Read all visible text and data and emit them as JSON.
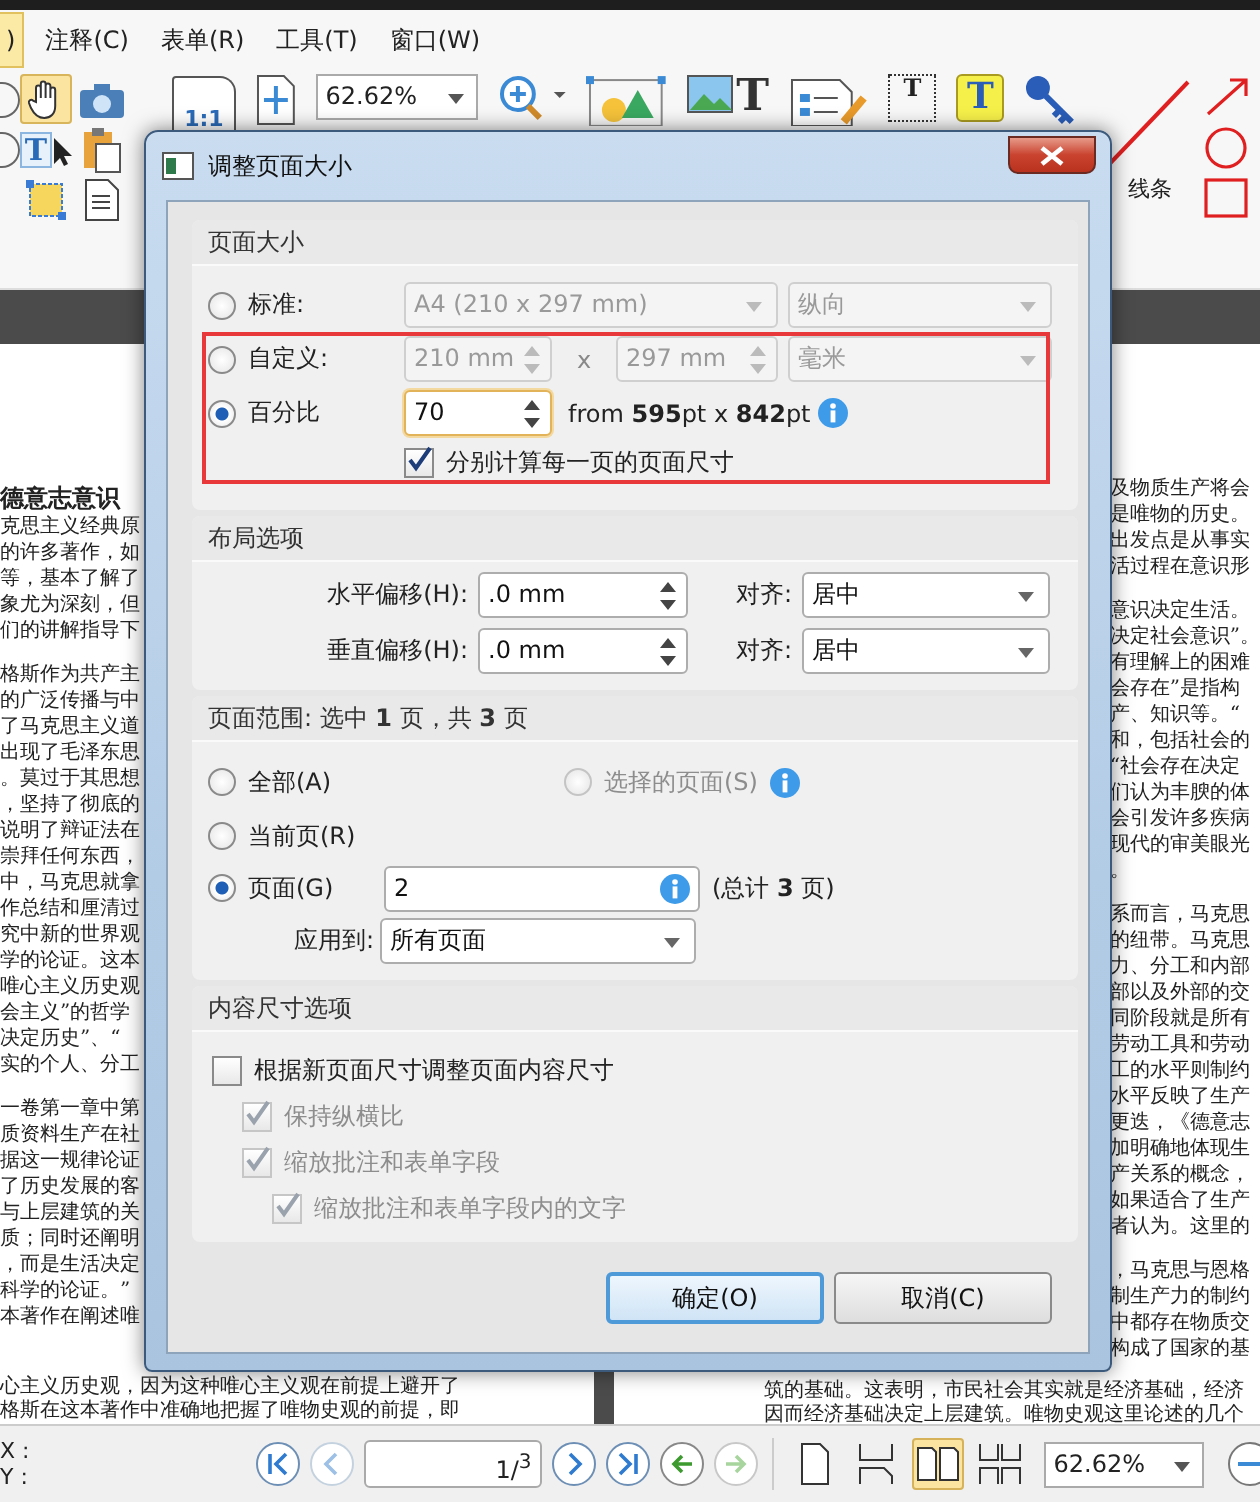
{
  "menu_bar": [
    {
      "label": ")",
      "selected": true
    },
    {
      "label": "注释(C)",
      "selected": false
    },
    {
      "label": "表单(R)",
      "selected": false
    },
    {
      "label": "工具(T)",
      "selected": false
    },
    {
      "label": "窗口(W)",
      "selected": false
    }
  ],
  "toolbar": {
    "left_tools": [
      {
        "kind": "ellipse",
        "selected": false
      },
      {
        "kind": "hand",
        "selected": true
      },
      {
        "kind": "camera",
        "selected": false
      },
      {
        "kind": "ellipse",
        "selected": false
      },
      {
        "kind": "text-select",
        "glyph": "T",
        "selected": false
      },
      {
        "kind": "clipboard",
        "selected": false
      },
      {
        "kind": "select-box",
        "selected": false
      },
      {
        "kind": "document",
        "selected": false
      }
    ],
    "tools": [
      {
        "kind": "actual-size",
        "glyph": "1:1"
      },
      {
        "kind": "fit-page"
      },
      {
        "kind": "zoom-box",
        "value": "62.62%"
      },
      {
        "kind": "zoom-in"
      },
      {
        "kind": "shape"
      },
      {
        "kind": "image-text",
        "glyph": "T"
      },
      {
        "kind": "form-list"
      },
      {
        "kind": "text-field",
        "glyph": "T"
      },
      {
        "kind": "typewriter",
        "glyph": "T"
      },
      {
        "kind": "key"
      }
    ],
    "draw_tools": [
      {
        "kind": "arrow"
      },
      {
        "kind": "circle"
      },
      {
        "kind": "rectangle"
      }
    ],
    "line_label": "线条"
  },
  "left_page": {
    "heading": "德意志意识",
    "paragraphs": [
      [
        "克思主义经典原",
        "的许多著作，如",
        "等，基本了解了",
        "象尤为深刻，但",
        "们的讲解指导下"
      ],
      [
        "格斯作为共产主",
        "的广泛传播与中",
        "了马克思主义道",
        "出现了毛泽东思",
        "。莫过于其思想",
        "，坚持了彻底的",
        "说明了辩证法在",
        "崇拜任何东西，",
        "中，马克思就拿",
        "作总结和厘清过",
        "究中新的世界观",
        "学的论证。这本",
        "唯心主义历史观",
        "会主义”的哲学",
        "决定历史”、“",
        "实的个人、分工"
      ],
      [
        "一卷第一章中第",
        "质资料生产在社",
        "据这一规律论证",
        "了历史发展的客",
        "与上层建筑的关",
        "质；同时还阐明",
        "，而是生活决定",
        "科学的论证。”",
        "本著作在阐述唯"
      ]
    ],
    "tail": [
      "心主义历史观，因为这种唯心主义观在前提上避开了",
      "格斯在这本著作中准确地把握了唯物史观的前提，即"
    ]
  },
  "right_page": {
    "paragraphs": [
      [
        "及物质生产将会",
        "是唯物的历史。",
        "出发点是从事实",
        "活过程在意识形"
      ],
      [
        "意识决定生活。",
        "决定社会意识”。",
        "有理解上的困难",
        "会存在”是指构",
        "产、知识等。“",
        "和，包括社会的",
        "“社会存在决定",
        "们认为丰腴的体",
        "会引发许多疾病",
        "现代的审美眼光",
        "。"
      ],
      [
        "系而言，马克思",
        "的纽带。马克思",
        "力、分工和内部",
        "部以及外部的交",
        "同阶段就是所有",
        "劳动工具和劳动",
        "工的水平则制约",
        "水平反映了生产",
        "更迭，《德意志",
        "加明确地体现生",
        "产关系的概念，",
        "如果适合了生产",
        "者认为。这里的"
      ],
      [
        "，马克思与恩格",
        "制生产力的制约",
        "中都存在物质交",
        "构成了国家的基"
      ]
    ],
    "tail": [
      "筑的基础。这表明，市民社会其实就是经济基础，经济",
      "因而经济基础决定上层建筑。唯物史观这里论述的几个"
    ]
  },
  "dialog": {
    "title": "调整页面大小",
    "page_size": {
      "heading": "页面大小",
      "options": [
        {
          "kind": "standard",
          "label": "标准:",
          "selected": false,
          "size": "A4 (210 x 297 mm)",
          "orientation": "纵向"
        },
        {
          "kind": "custom",
          "label": "自定义:",
          "selected": false,
          "width": "210 mm",
          "times": "x",
          "height": "297 mm",
          "unit": "毫米"
        },
        {
          "kind": "percent",
          "label": "百分比",
          "selected": true,
          "value": "70",
          "from": "from **595**pt x **842**pt"
        }
      ],
      "per_page": {
        "label": "分别计算每一页的页面尺寸",
        "checked": true
      },
      "annotation_frame": true
    },
    "layout": {
      "heading": "布局选项",
      "rows": [
        {
          "label": "水平偏移(H):",
          "value": ".0 mm",
          "align_label": "对齐:",
          "align": "居中"
        },
        {
          "label": "垂直偏移(H):",
          "value": ".0 mm",
          "align_label": "对齐:",
          "align": "居中"
        }
      ]
    },
    "page_range": {
      "heading": "页面范围: 选中 **1** 页，共 **3** 页",
      "options": [
        {
          "label": "全部(A)",
          "selected": false,
          "disabled": false
        },
        {
          "label": "选择的页面(S)",
          "selected": false,
          "disabled": true
        },
        {
          "label": "当前页(R)",
          "selected": false,
          "disabled": false
        },
        {
          "label": "页面(G)",
          "selected": true,
          "disabled": false
        }
      ],
      "pages_value": "2",
      "total": "(总计 **3** 页)",
      "apply_label": "应用到:",
      "apply_value": "所有页面"
    },
    "content_size": {
      "heading": "内容尺寸选项",
      "options": [
        {
          "label": "根据新页面尺寸调整页面内容尺寸",
          "checked": false,
          "disabled": false,
          "children": [
            {
              "label": "保持纵横比",
              "checked": true,
              "disabled": true
            },
            {
              "label": "缩放批注和表单字段",
              "checked": true,
              "disabled": true,
              "children": [
                {
                  "label": "缩放批注和表单字段内的文字",
                  "checked": true,
                  "disabled": true
                }
              ]
            }
          ]
        }
      ]
    },
    "buttons": [
      {
        "label": "确定(O)",
        "default": true
      },
      {
        "label": "取消(C)",
        "default": false
      }
    ]
  },
  "status_bar": {
    "coords": [
      "X :",
      "Y :"
    ],
    "nav": [
      {
        "kind": "first",
        "disabled": false
      },
      {
        "kind": "prev",
        "disabled": true
      }
    ],
    "page": "1/$^{3}$",
    "nav_after": [
      {
        "kind": "next",
        "disabled": false
      },
      {
        "kind": "last",
        "disabled": false
      },
      {
        "kind": "back",
        "disabled": false
      },
      {
        "kind": "forward",
        "disabled": true
      }
    ],
    "views": [
      {
        "kind": "single",
        "selected": false
      },
      {
        "kind": "continuous",
        "selected": false
      },
      {
        "kind": "facing",
        "selected": true
      },
      {
        "kind": "continuous-facing",
        "selected": false
      }
    ],
    "zoom": "62.62%"
  }
}
